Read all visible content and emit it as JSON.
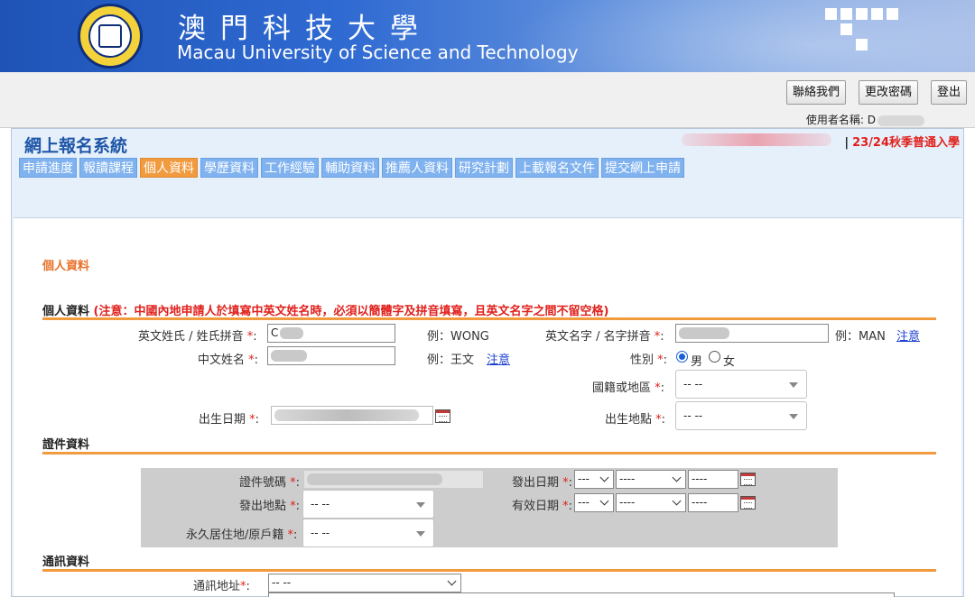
{
  "banner": {
    "title_cn": "澳門科技大學",
    "title_en": "Macau University of Science and Technology"
  },
  "topbar": {
    "contact_label": "聯絡我們",
    "change_password_label": "更改密碼",
    "logout_label": "登出",
    "username_label": "使用者名稱: D"
  },
  "system": {
    "title": "網上報名系統",
    "season": "23/24秋季普通入學",
    "season_sep": "|"
  },
  "tabs": [
    {
      "label": "申請進度"
    },
    {
      "label": "報讀課程"
    },
    {
      "label": "個人資料"
    },
    {
      "label": "學歷資料"
    },
    {
      "label": "工作經驗"
    },
    {
      "label": "輔助資料"
    },
    {
      "label": "推薦人資料"
    },
    {
      "label": "研究計劃"
    },
    {
      "label": "上載報名文件"
    },
    {
      "label": "提交網上申請"
    }
  ],
  "active_tab": "個人資料",
  "colors": {
    "accent_orange": "#f19a3e",
    "tab_blue": "#7fb2ef",
    "title_blue": "#1f56a8",
    "alert_red": "#e0201b"
  },
  "personal": {
    "heading": "個人資料",
    "sub_heading": "個人資料",
    "sub_note": "(注意：中國內地申請人於填寫中英文姓名時，必須以簡體字及拼音填寫，且英文名字之間不留空格)",
    "surname_label": "英文姓氏 / 姓氏拼音",
    "surname_value": "C",
    "surname_example": "例：WONG",
    "given_label": "英文名字 / 名字拼音",
    "given_example": "例：MAN",
    "given_note_link": "注意",
    "cn_name_label": "中文姓名",
    "cn_name_example": "例：王文",
    "cn_name_note_link": "注意",
    "gender_label": "性別",
    "gender_male": "男",
    "gender_female": "女",
    "nationality_label": "國籍或地區",
    "nationality_value": "-- --",
    "dob_label": "出生日期",
    "birthplace_label": "出生地點",
    "birthplace_value": "-- --",
    "required_mark": "*",
    "colon": ":"
  },
  "document": {
    "heading": "證件資料",
    "id_number_label": "證件號碼",
    "issue_date_label": "發出日期",
    "issue_place_label": "發出地點",
    "issue_place_value": "-- --",
    "expiry_date_label": "有效日期",
    "permanent_residence_label": "永久居住地/原戶籍",
    "permanent_residence_value": "-- --",
    "day_placeholder": "---",
    "month_placeholder": "----",
    "year_placeholder": "----"
  },
  "contact": {
    "heading": "通訊資料",
    "address_label": "通訊地址",
    "address_value": "-- --"
  }
}
